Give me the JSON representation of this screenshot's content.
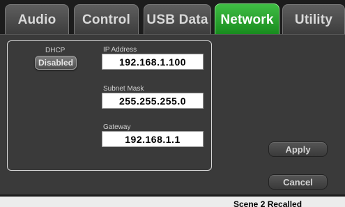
{
  "tabs": [
    {
      "label": "Audio",
      "active": false
    },
    {
      "label": "Control",
      "active": false
    },
    {
      "label": "USB Data",
      "active": false
    },
    {
      "label": "Network",
      "active": true
    },
    {
      "label": "Utility",
      "active": false
    }
  ],
  "network": {
    "dhcp_label": "DHCP",
    "dhcp_value": "Disabled",
    "ip_label": "IP Address",
    "ip_value": "192.168.1.100",
    "subnet_label": "Subnet Mask",
    "subnet_value": "255.255.255.0",
    "gateway_label": "Gateway",
    "gateway_value": "192.168.1.1"
  },
  "actions": {
    "apply_label": "Apply",
    "cancel_label": "Cancel"
  },
  "status": {
    "text": "Scene 2 Recalled"
  },
  "colors": {
    "active_tab": "#22a428",
    "background": "#3a3a3a"
  }
}
